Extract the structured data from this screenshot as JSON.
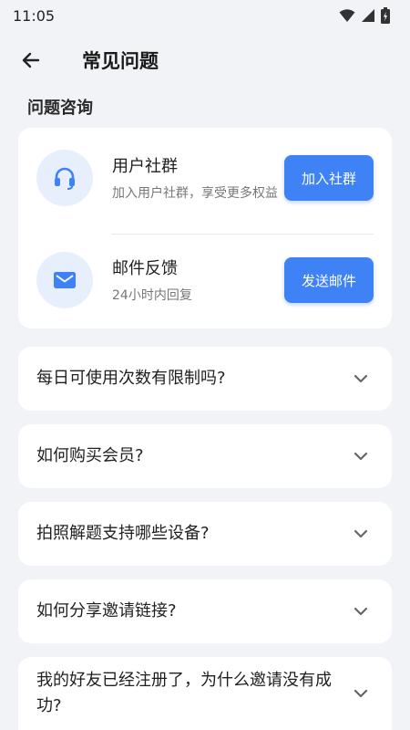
{
  "status_bar": {
    "time": "11:05"
  },
  "header": {
    "title": "常见问题"
  },
  "section": {
    "title": "问题咨询"
  },
  "contacts": [
    {
      "title": "用户社群",
      "subtitle": "加入用户社群，享受更多权益",
      "button": "加入社群",
      "icon": "headset-icon"
    },
    {
      "title": "邮件反馈",
      "subtitle": "24小时内回复",
      "button": "发送邮件",
      "icon": "mail-icon"
    }
  ],
  "faqs": [
    {
      "question": "每日可使用次数有限制吗?"
    },
    {
      "question": "如何购买会员?"
    },
    {
      "question": "拍照解题支持哪些设备?"
    },
    {
      "question": "如何分享邀请链接?"
    },
    {
      "question": "我的好友已经注册了，为什么邀请没有成功?"
    }
  ],
  "colors": {
    "accent": "#3e82f6",
    "icon_bg": "#e8effc",
    "background": "#f2f3f7"
  }
}
